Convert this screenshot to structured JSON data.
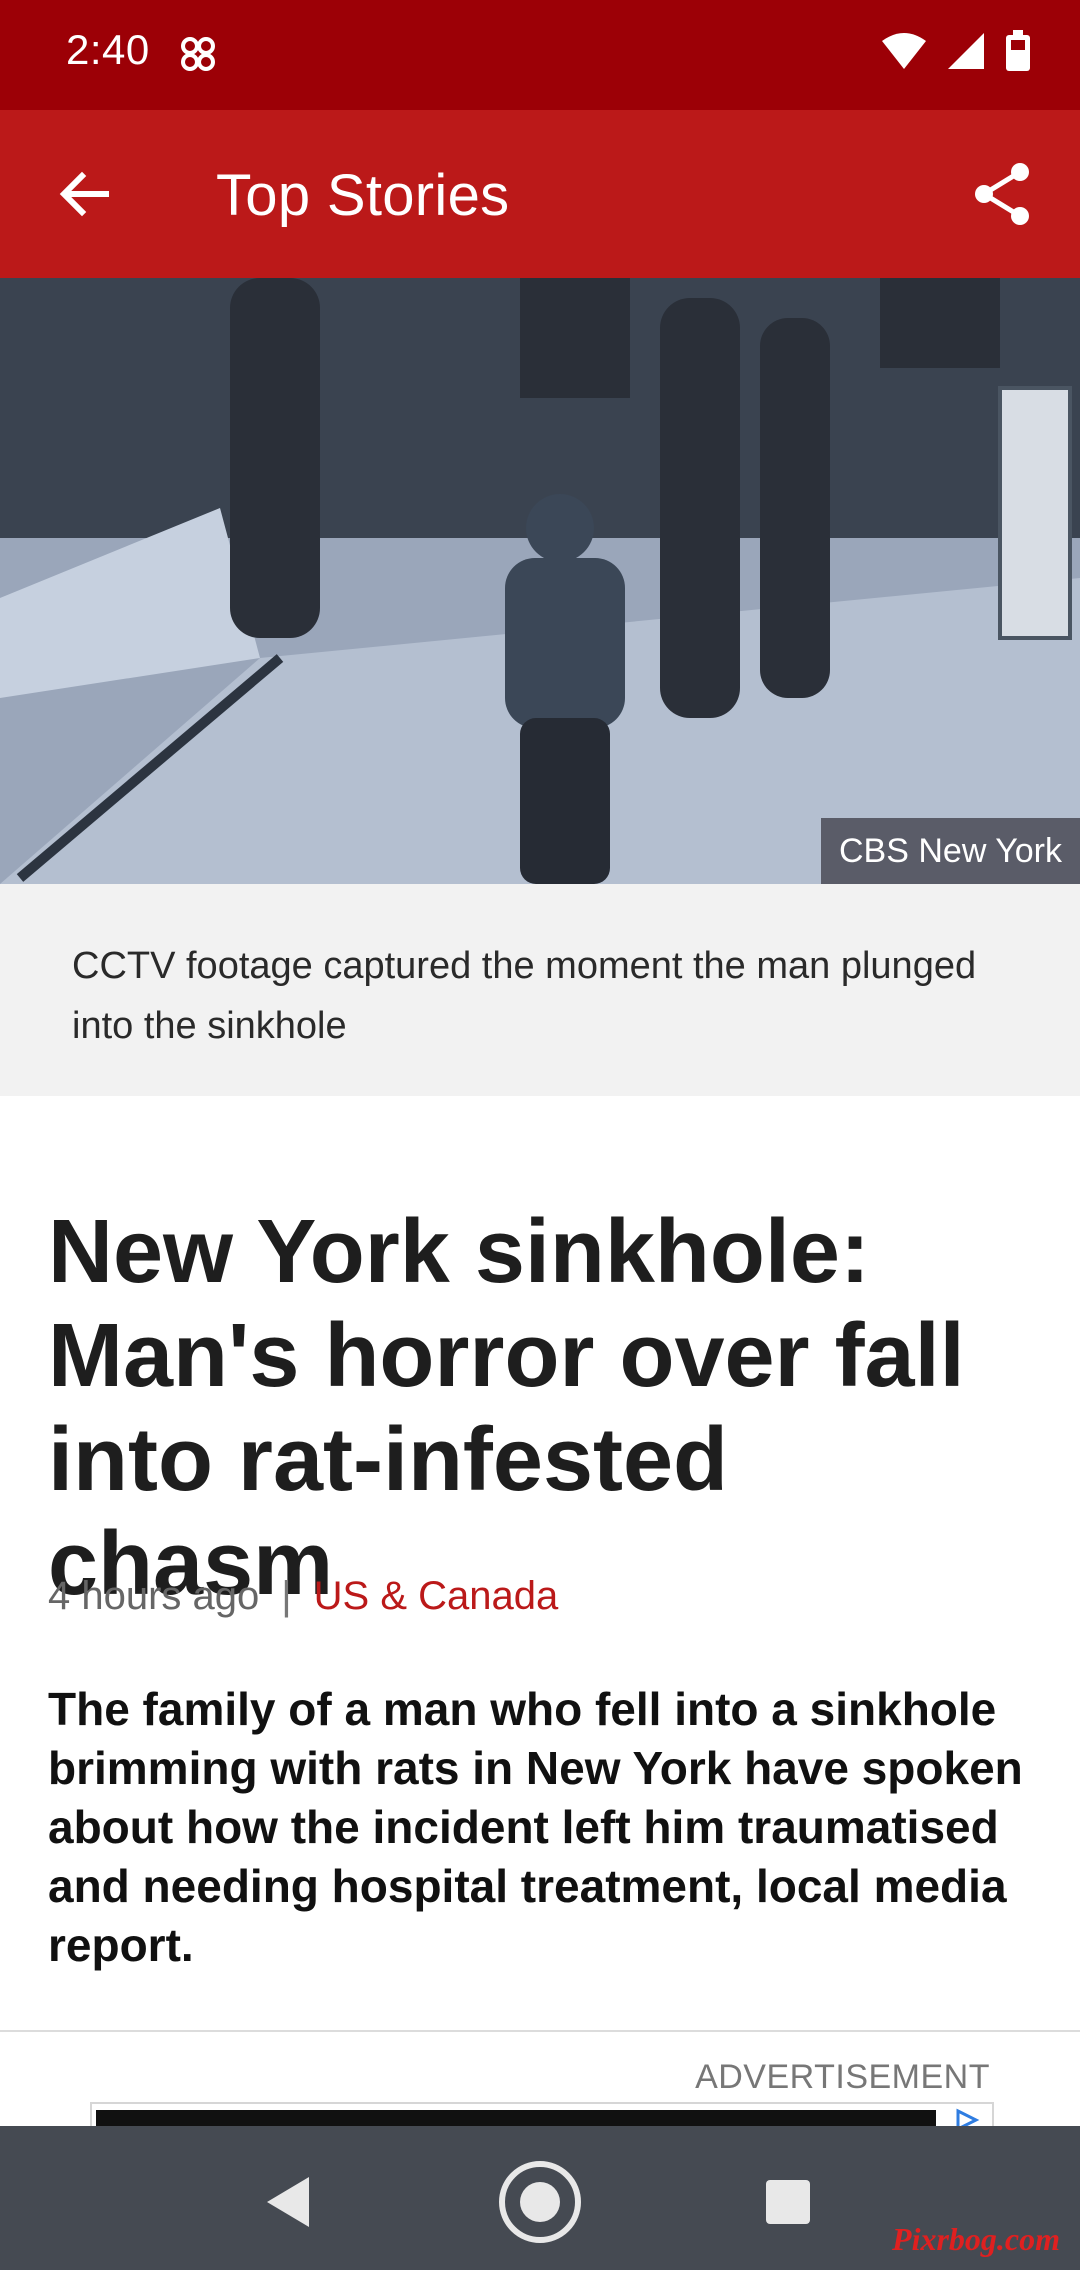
{
  "status_bar": {
    "time": "2:40",
    "icons": [
      "app-notification-icon",
      "wifi-icon",
      "cellular-signal-icon",
      "battery-icon"
    ]
  },
  "app_bar": {
    "title": "Top Stories",
    "back_icon": "arrow-left-icon",
    "share_icon": "share-icon"
  },
  "hero": {
    "image_description": "CCTV street footage",
    "credit": "CBS New York",
    "caption": "CCTV footage captured the moment the man plunged into the sinkhole"
  },
  "article": {
    "headline": "New York sinkhole: Man's horror over fall into rat-infested chasm",
    "time_ago": "4 hours ago",
    "separator": "|",
    "topic": "US & Canada",
    "summary": "The family of a man who fell into a sinkhole brimming with rats in New York have spoken about how the incident left him traumatised and needing hospital treatment, local media report."
  },
  "advertisement": {
    "label": "ADVERTISEMENT"
  },
  "nav_bar": {
    "buttons": [
      "back-triangle-icon",
      "home-circle-icon",
      "recents-square-icon"
    ]
  },
  "watermark": "Pixrbog.com",
  "colors": {
    "status_bar": "#9c0006",
    "app_bar": "#bb1919",
    "topic_link": "#bb1919",
    "nav_bar": "#454a52"
  }
}
